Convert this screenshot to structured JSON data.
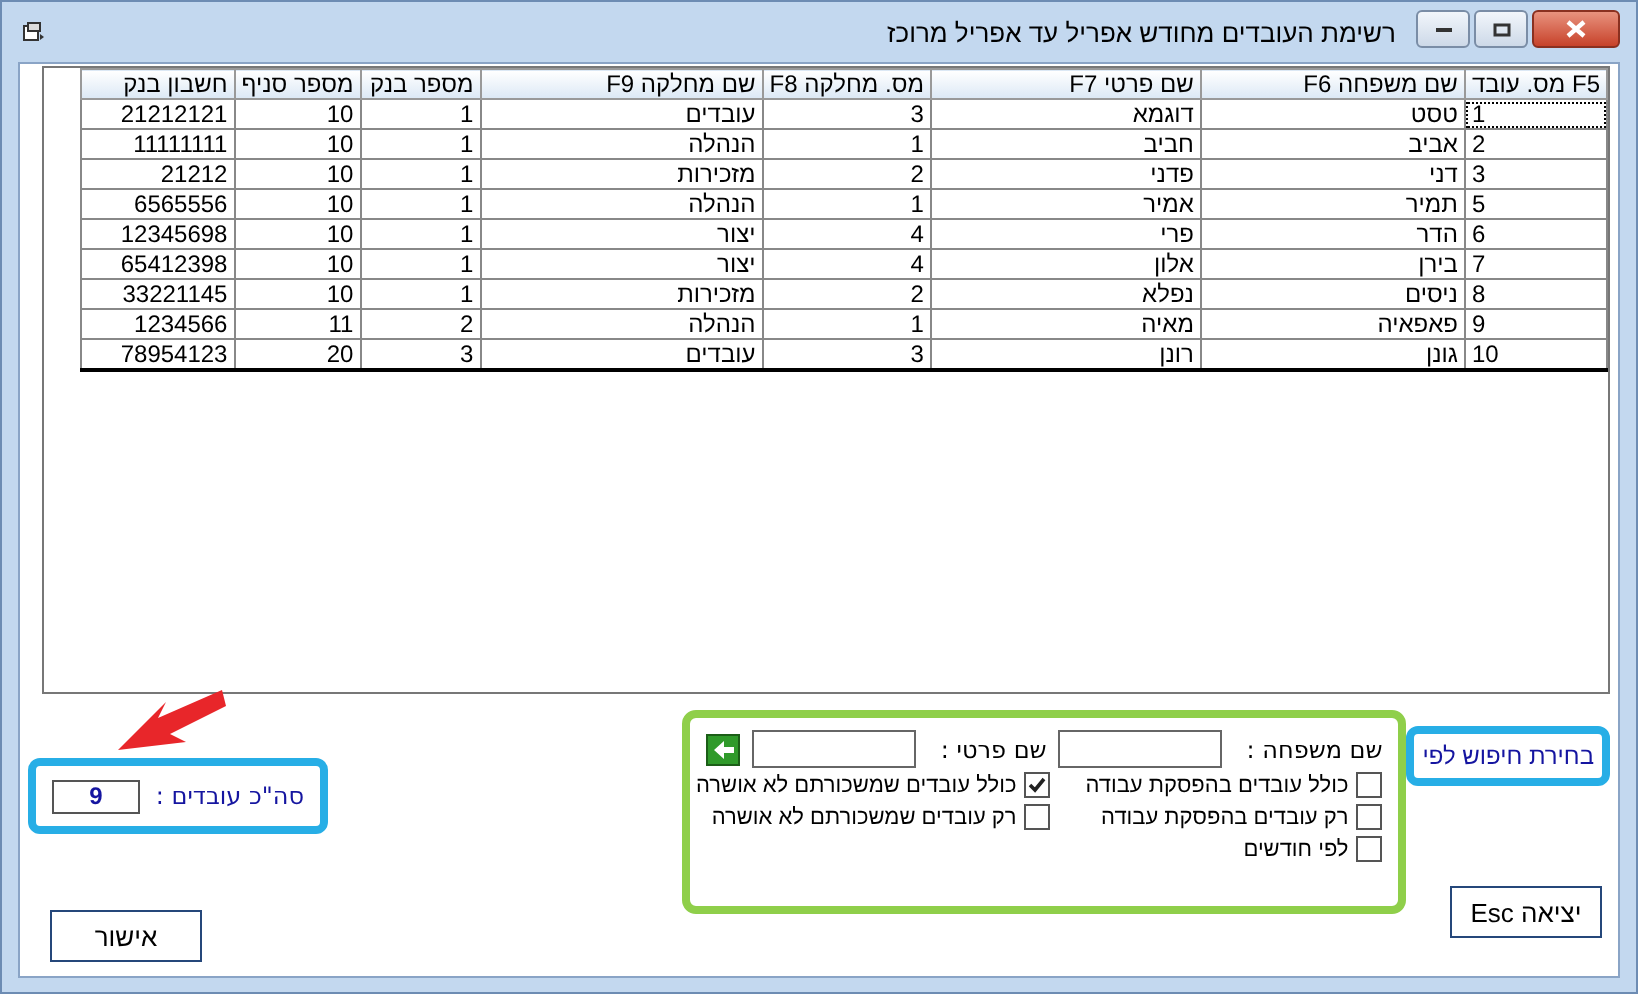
{
  "window": {
    "title": "רשימת העובדים מחודש אפריל עד אפריל מרוכז"
  },
  "table": {
    "columns": [
      "F5 מס. עובד",
      "שם משפחה F6",
      "שם פרטי F7",
      "מס. מחלקה F8",
      "שם מחלקה F9",
      "מספר בנק",
      "מספר סניף",
      "חשבון בנק"
    ],
    "rows": [
      {
        "focused": true,
        "cells": [
          "1",
          "טסט",
          "דוגמא",
          "3",
          "עובדים",
          "1",
          "10",
          "21212121"
        ]
      },
      {
        "focused": false,
        "cells": [
          "2",
          "אביב",
          "חביב",
          "1",
          "הנהלה",
          "1",
          "10",
          "11111111"
        ]
      },
      {
        "focused": false,
        "cells": [
          "3",
          "דני",
          "פדני",
          "2",
          "מזכירות",
          "1",
          "10",
          "21212"
        ]
      },
      {
        "focused": false,
        "cells": [
          "5",
          "תמיר",
          "אמיר",
          "1",
          "הנהלה",
          "1",
          "10",
          "6565556"
        ]
      },
      {
        "focused": false,
        "cells": [
          "6",
          "הדר",
          "פרי",
          "4",
          "יצור",
          "1",
          "10",
          "12345698"
        ]
      },
      {
        "focused": false,
        "cells": [
          "7",
          "בירן",
          "אלון",
          "4",
          "יצור",
          "1",
          "10",
          "65412398"
        ]
      },
      {
        "focused": false,
        "cells": [
          "8",
          "ניסים",
          "נפלא",
          "2",
          "מזכירות",
          "1",
          "10",
          "33221145"
        ]
      },
      {
        "focused": false,
        "cells": [
          "9",
          "פאפאיה",
          "מאיה",
          "1",
          "הנהלה",
          "2",
          "11",
          "1234566"
        ]
      },
      {
        "focused": false,
        "cells": [
          "10",
          "גונן",
          "רונן",
          "3",
          "עובדים",
          "3",
          "20",
          "78954123"
        ]
      }
    ]
  },
  "search": {
    "label": "בחירת חיפוש לפי",
    "fields": [
      {
        "label": "שם משפחה :"
      },
      {
        "label": "שם פרטי :"
      }
    ],
    "options": [
      {
        "label": "כולל עובדים בהפסקת עבודה",
        "checked": false
      },
      {
        "label": "כולל עובדים שמשכורתם לא אושרה",
        "checked": true
      },
      {
        "label": "רק עובדים בהפסקת עבודה",
        "checked": false
      },
      {
        "label": "רק עובדים שמשכורתם לא אושרה",
        "checked": false
      },
      {
        "label": "לפי חודשים",
        "checked": false
      }
    ]
  },
  "total": {
    "label": "סה\"כ עובדים :",
    "value": "9"
  },
  "buttons": [
    {
      "label": "אישור"
    },
    {
      "label": "יציאה Esc"
    }
  ]
}
